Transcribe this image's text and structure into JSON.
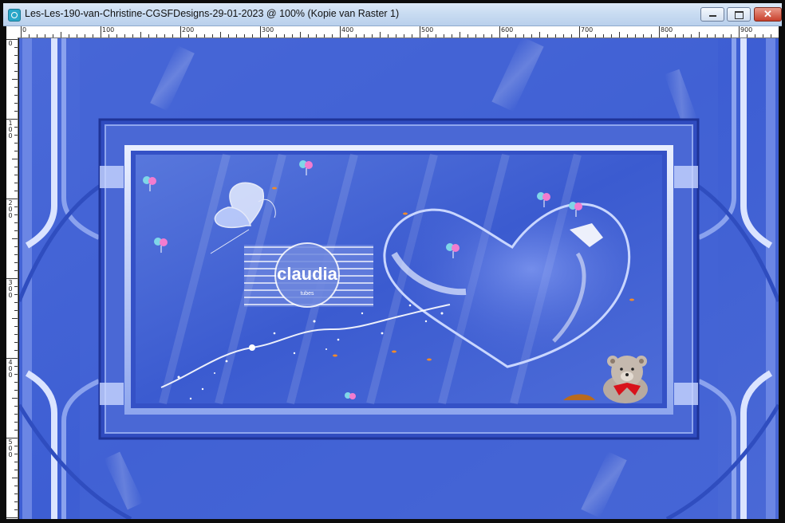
{
  "window": {
    "title": "Les-Les-190-van-Christine-CGSFDesigns-29-01-2023 @ 100% (Kopie van Raster 1)",
    "app_icon": "paintshop-pro-icon",
    "minimize_icon": "minimize-icon",
    "maximize_icon": "maximize-icon",
    "close_icon": "close-icon",
    "close_glyph": "✕"
  },
  "rulers": {
    "horizontal_labels": [
      "0",
      "100",
      "200",
      "300",
      "400",
      "500",
      "600",
      "700",
      "800",
      "900"
    ],
    "vertical_labels": [
      "0",
      "100",
      "200",
      "300",
      "400",
      "500"
    ]
  },
  "canvas": {
    "image_content": "blue layered frame design with heart, butterfly, teddy bear and hearts balloons",
    "watermark_text": "claudia",
    "watermark_subtext": "tubes",
    "colors": {
      "base": "#3b5ccf",
      "frame_light": "#c8d6ff",
      "deep": "#2a40a8"
    }
  }
}
